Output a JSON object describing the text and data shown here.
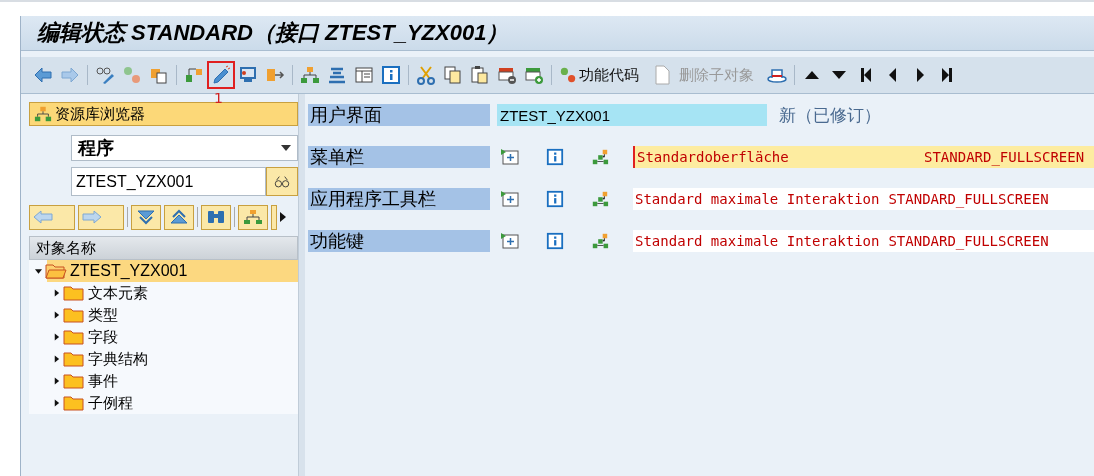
{
  "window": {
    "title": "编辑状态 STANDARD（接口 ZTEST_YZX001）"
  },
  "toolbar": {
    "edit_tool_marked": true,
    "marker_label": "1",
    "function_code": {
      "label": "功能代码"
    },
    "delete_subobject": {
      "label": "删除子对象",
      "disabled": true
    }
  },
  "sidebar": {
    "browser_button": {
      "label": "资源库浏览器",
      "selected": true
    },
    "object_type": {
      "value": "程序"
    },
    "object_name": {
      "value": "ZTEST_YZX001"
    },
    "tree": {
      "column": "对象名称",
      "items": [
        {
          "label": "ZTEST_YZX001",
          "selected": true,
          "expanded": true,
          "children": [
            {
              "label": "文本元素",
              "expanded": false
            },
            {
              "label": "类型",
              "expanded": false
            },
            {
              "label": "字段",
              "expanded": false
            },
            {
              "label": "字典结构",
              "expanded": false
            },
            {
              "label": "事件",
              "expanded": false
            },
            {
              "label": "子例程",
              "expanded": false
            }
          ]
        }
      ]
    }
  },
  "interface": {
    "label": "用户界面",
    "value": "ZTEST_YZX001",
    "status": "新（已修订）"
  },
  "rows": [
    {
      "label": "菜单栏",
      "text": "Standardoberfläche",
      "code": "STANDARD_FULLSCREEN",
      "selected": true
    },
    {
      "label": "应用程序工具栏",
      "text": "Standard maximale Interaktion",
      "code": "STANDARD_FULLSCREEN",
      "selected": false
    },
    {
      "label": "功能键",
      "text": "Standard maximale Interaktion",
      "code": "STANDARD_FULLSCREEN",
      "selected": false
    }
  ]
}
